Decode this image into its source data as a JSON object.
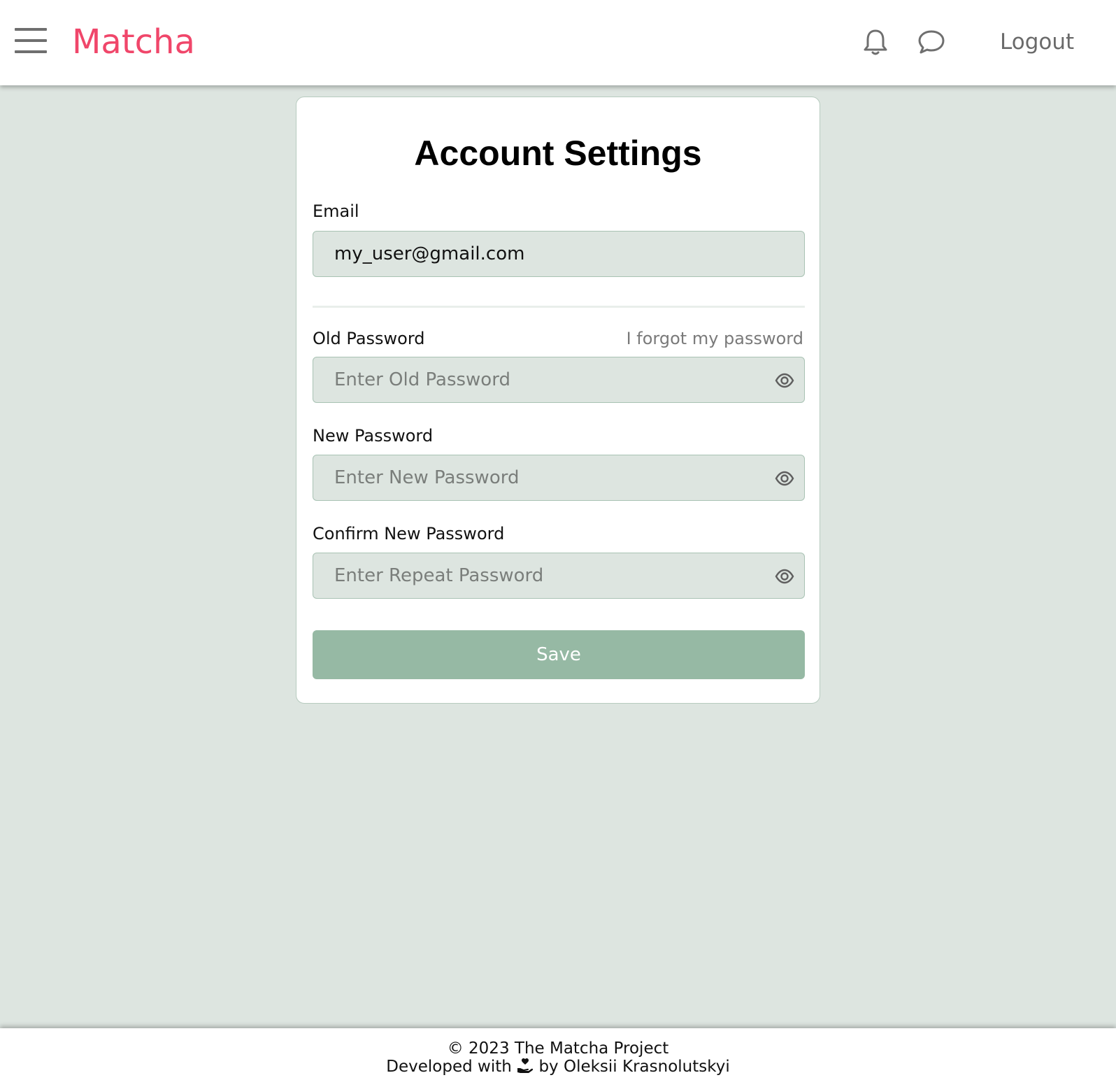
{
  "header": {
    "brand": "Matcha",
    "logout_label": "Logout",
    "icons": [
      "hamburger-menu-icon",
      "bell-icon",
      "chat-bubble-icon"
    ]
  },
  "settings": {
    "title": "Account Settings",
    "email_label": "Email",
    "email_value": "my_user@gmail.com",
    "old_password_label": "Old Password",
    "forgot_link": "I forgot my password",
    "old_password_placeholder": "Enter Old Password",
    "new_password_label": "New Password",
    "new_password_placeholder": "Enter New Password",
    "confirm_password_label": "Confirm New Password",
    "confirm_password_placeholder": "Enter Repeat Password",
    "save_label": "Save"
  },
  "footer": {
    "copyright": "© 2023 The Matcha Project",
    "developed_prefix": "Developed with",
    "developed_suffix": "by Oleksii Krasnolutskyi"
  },
  "colors": {
    "brand": "#f0466a",
    "background": "#dde5e0",
    "button": "#96b9a4"
  }
}
